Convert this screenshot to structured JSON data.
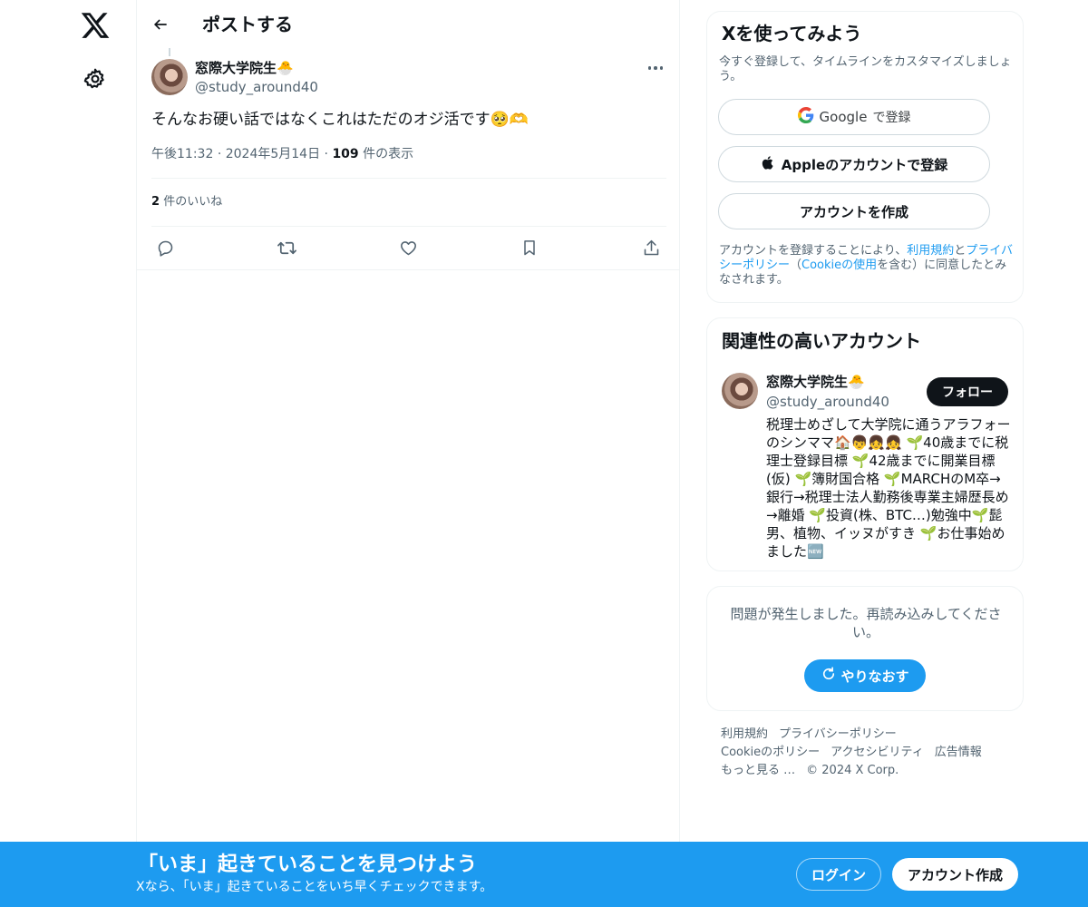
{
  "nav": {
    "logo_icon": "x-logo-icon",
    "settings_icon": "gear-icon"
  },
  "header": {
    "title": "ポストする"
  },
  "post": {
    "author_name": "窓際大学院生🐣",
    "author_handle": "@study_around40",
    "text": "そんなお硬い話ではなくこれはただのオジ活です🥺🫶",
    "time": "午後11:32",
    "date": "2024年5月14日",
    "views_count": "109",
    "views_label": "件の表示",
    "likes_count": "2",
    "likes_label": "件のいいね"
  },
  "signup_card": {
    "title": "Xを使ってみよう",
    "note": "今すぐ登録して、タイムラインをカスタマイズしましょう。",
    "google_brand": "Google",
    "google_suffix": "で登録",
    "apple_label": "Appleのアカウントで登録",
    "create_label": "アカウントを作成",
    "legal_1": "アカウントを登録することにより、",
    "legal_terms": "利用規約",
    "legal_and": "と",
    "legal_privacy": "プライバシーポリシー",
    "legal_paren_open": "（",
    "legal_cookie": "Cookieの使用",
    "legal_2": "を含む）に同意したとみなされます。"
  },
  "related_card": {
    "title": "関連性の高いアカウント",
    "name": "窓際大学院生🐣",
    "handle": "@study_around40",
    "follow_label": "フォロー",
    "bio": "税理士めざして大学院に通うアラフォーのシンママ🏠👦👧👧 🌱40歳までに税理士登録目標 🌱42歳までに開業目標(仮) 🌱簿財国合格 🌱MARCHのM卒→銀行→税理士法人勤務後専業主婦歴長め→離婚 🌱投資(株、BTC…)勉強中🌱髭男、植物、イッヌがすき 🌱お仕事始めました🆕"
  },
  "error_card": {
    "message": "問題が発生しました。再読み込みしてください。",
    "retry_label": "やりなおす"
  },
  "footer": {
    "links": [
      "利用規約",
      "プライバシーポリシー",
      "Cookieのポリシー",
      "アクセシビリティ",
      "広告情報",
      "もっと見る …",
      "© 2024 X Corp."
    ]
  },
  "banner": {
    "title": "「いま」起きていることを見つけよう",
    "subtitle": "Xなら、「いま」起きていることをいち早くチェックできます。",
    "login_label": "ログイン",
    "create_label": "アカウント作成"
  },
  "colors": {
    "accent": "#1d9bf0",
    "text": "#0f1419",
    "muted": "#536471",
    "border": "#eff3f4"
  }
}
